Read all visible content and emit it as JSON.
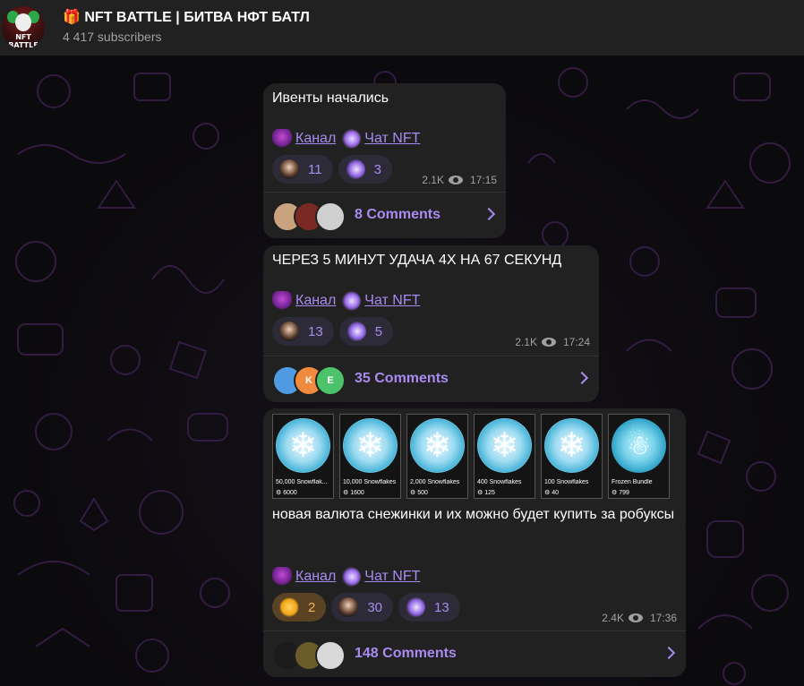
{
  "channel": {
    "title": "🎁 NFT BATTLE | БИТВА НФТ БАТЛ",
    "subscribers": "4 417 subscribers",
    "avatar_text": "NFT BATTLE"
  },
  "links": {
    "kanal": "Канал",
    "chat": "Чат NFT"
  },
  "posts": [
    {
      "text": "Ивенты начались",
      "reactions": [
        {
          "icon": "man-emoji-icon",
          "count": "11"
        },
        {
          "icon": "ghost-emoji-icon",
          "count": "3"
        }
      ],
      "views": "2.1K",
      "time": "17:15",
      "comments": "8 Comments",
      "commenter_initials": [
        "",
        "",
        ""
      ]
    },
    {
      "text": "ЧЕРЕЗ 5 МИНУТ УДАЧА 4Х НА 67 СЕКУНД",
      "reactions": [
        {
          "icon": "man-emoji-icon",
          "count": "13"
        },
        {
          "icon": "ghost-emoji-icon",
          "count": "5"
        }
      ],
      "views": "2.1K",
      "time": "17:24",
      "comments": "35 Comments",
      "commenter_initials": [
        "",
        "K",
        "E"
      ]
    },
    {
      "text": "новая валюта снежинки и их можно будет купить за робуксы",
      "cards": [
        {
          "name": "50,000 Snowflak...",
          "price": "6000"
        },
        {
          "name": "10,000 Snowflakes",
          "price": "1600"
        },
        {
          "name": "2,000 Snowflakes",
          "price": "500"
        },
        {
          "name": "400 Snowflakes",
          "price": "125"
        },
        {
          "name": "100 Snowflakes",
          "price": "40"
        },
        {
          "name": "Frozen Bundle",
          "price": "799"
        }
      ],
      "reactions": [
        {
          "icon": "star-icon",
          "count": "2"
        },
        {
          "icon": "man-emoji-icon",
          "count": "30"
        },
        {
          "icon": "ghost-emoji-icon",
          "count": "13"
        }
      ],
      "views": "2.4K",
      "time": "17:36",
      "comments": "148 Comments",
      "commenter_initials": [
        "",
        "",
        ""
      ]
    }
  ],
  "colors": {
    "accent": "#a78bf0",
    "bubble": "#212121",
    "header": "#212121",
    "gold": "#f3b45a"
  }
}
